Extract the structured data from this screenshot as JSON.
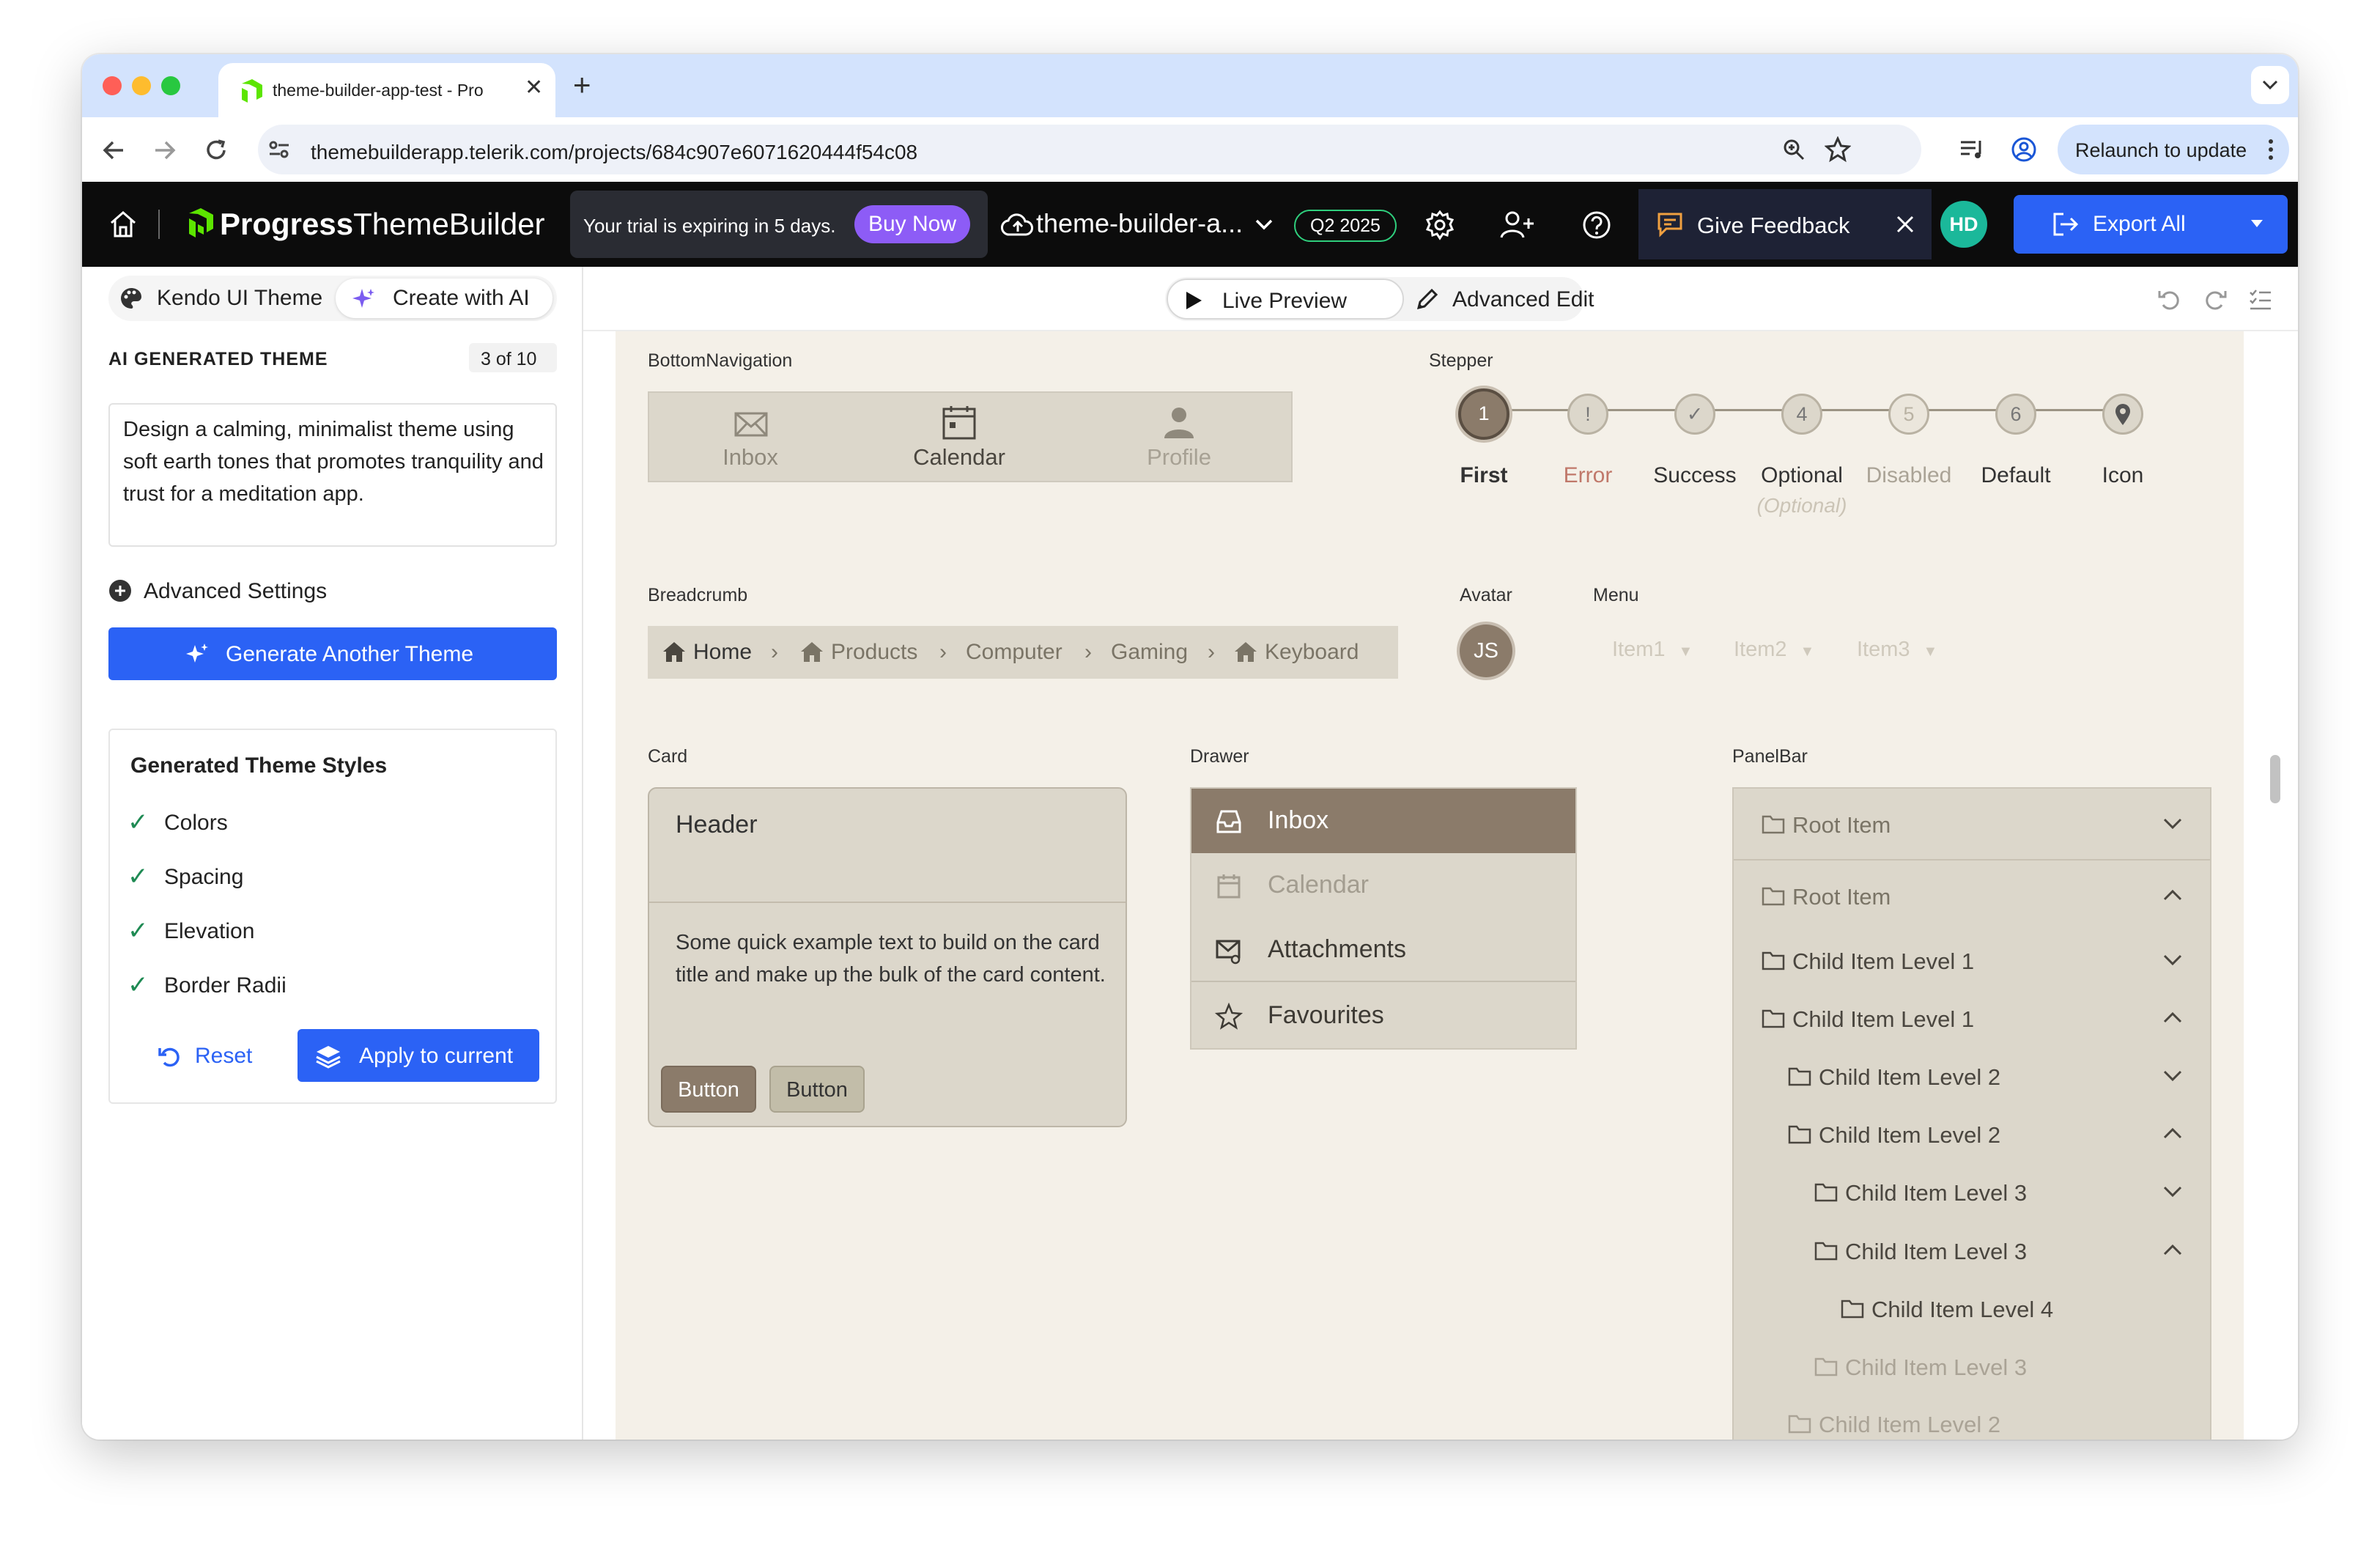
{
  "browser": {
    "tab_title": "theme-builder-app-test - Pro",
    "url": "themebuilderapp.telerik.com/projects/684c907e6071620444f54c08",
    "relaunch_label": "Relaunch to update"
  },
  "header": {
    "logo_brand": "Progress",
    "logo_product": "ThemeBuilder",
    "trial_text": "Your trial is expiring in 5 days.",
    "buy_now": "Buy Now",
    "project_name": "theme-builder-a...",
    "version_badge": "Q2 2025",
    "feedback_label": "Give Feedback",
    "user_initials": "HD",
    "export_label": "Export All"
  },
  "sidebar": {
    "tabs": [
      "Kendo UI Theme",
      "Create with AI"
    ],
    "section_title": "AI GENERATED THEME",
    "counter": "3 of 10",
    "prompt": "Design a calming, minimalist theme using soft earth tones that promotes tranquility and trust for a meditation app.",
    "advanced_settings": "Advanced Settings",
    "generate_button": "Generate Another Theme",
    "styles_title": "Generated Theme Styles",
    "styles": [
      "Colors",
      "Spacing",
      "Elevation",
      "Border Radii"
    ],
    "reset_label": "Reset",
    "apply_label": "Apply to current"
  },
  "toolbar": {
    "live_preview": "Live Preview",
    "advanced_edit": "Advanced Edit"
  },
  "preview": {
    "bottom_navigation": {
      "label": "BottomNavigation",
      "items": [
        "Inbox",
        "Calendar",
        "Profile"
      ]
    },
    "stepper": {
      "label": "Stepper",
      "steps": [
        {
          "marker": "1",
          "label": "First"
        },
        {
          "marker": "!",
          "label": "Error"
        },
        {
          "marker": "✓",
          "label": "Success"
        },
        {
          "marker": "4",
          "label": "Optional",
          "note": "(Optional)"
        },
        {
          "marker": "5",
          "label": "Disabled"
        },
        {
          "marker": "6",
          "label": "Default"
        },
        {
          "marker": "",
          "label": "Icon"
        }
      ]
    },
    "breadcrumb": {
      "label": "Breadcrumb",
      "items": [
        "Home",
        "Products",
        "Computer",
        "Gaming",
        "Keyboard"
      ]
    },
    "avatar": {
      "label": "Avatar",
      "initials": "JS"
    },
    "menu": {
      "label": "Menu",
      "items": [
        "Item1",
        "Item2",
        "Item3"
      ]
    },
    "card": {
      "label": "Card",
      "header": "Header",
      "body": "Some quick example text to build on the card title and make up the bulk of the card content.",
      "buttons": [
        "Button",
        "Button"
      ]
    },
    "drawer": {
      "label": "Drawer",
      "items": [
        "Inbox",
        "Calendar",
        "Attachments",
        "Favourites"
      ]
    },
    "panelbar": {
      "label": "PanelBar",
      "items": [
        "Root Item",
        "Root Item",
        "Child Item Level 1",
        "Child Item Level 1",
        "Child Item Level 2",
        "Child Item Level 2",
        "Child Item Level 3",
        "Child Item Level 3",
        "Child Item Level 4",
        "Child Item Level 3",
        "Child Item Level 2"
      ]
    }
  },
  "colors": {
    "accent_blue": "#2b62f5",
    "canvas_bg": "#f4f0e8",
    "widget_bg": "#dcd7cb",
    "primary_earth": "#8b7b6a",
    "error": "#c0786a"
  }
}
